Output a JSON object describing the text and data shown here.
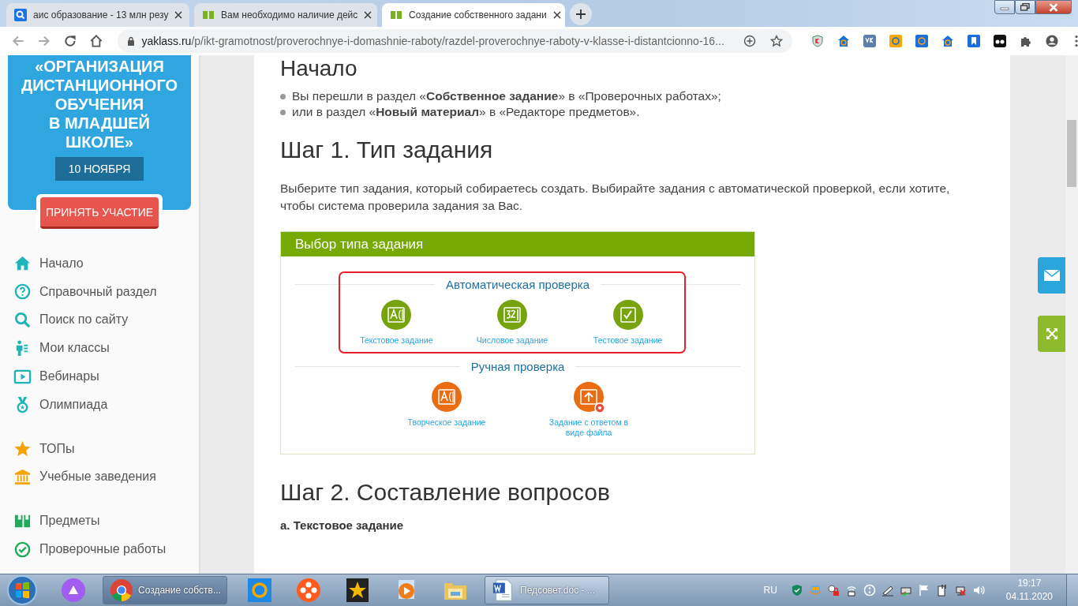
{
  "browser": {
    "tabs": [
      {
        "title": "аис образование - 13 млн резу",
        "selected": false
      },
      {
        "title": "Вам необходимо наличие дейс",
        "selected": false
      },
      {
        "title": "Создание собственного задани",
        "selected": true
      }
    ],
    "url": {
      "domain": "yaklass.ru",
      "path": "/p/ikt-gramotnost/proverochnye-i-domashnie-raboty/razdel-proverochnye-raboty-v-klasse-i-distantcionno-16..."
    }
  },
  "sidebar": {
    "banner": {
      "title_lines": [
        "«ОРГАНИЗАЦИЯ",
        "ДИСТАНЦИОННОГО",
        "ОБУЧЕНИЯ",
        "В МЛАДШЕЙ",
        "ШКОЛЕ»"
      ],
      "date": "10 НОЯБРЯ",
      "button": "ПРИНЯТЬ УЧАСТИЕ"
    },
    "nav_groups": [
      [
        "Начало",
        "Справочный раздел",
        "Поиск по сайту",
        "Мои классы",
        "Вебинары",
        "Олимпиада"
      ],
      [
        "ТОПы",
        "Учебные заведения"
      ],
      [
        "Предметы",
        "Проверочные работы"
      ]
    ]
  },
  "main": {
    "top_heading": "Начало",
    "bullets": [
      "Вы перешли в раздел «**Собственное задание**» в «Проверочных работах»;",
      "или в раздел «**Новый материал**» в «Редакторе предметов»."
    ],
    "step1": {
      "heading": "Шаг 1. Тип задания",
      "text": "Выберите тип задания, который собираетесь создать. Выбирайте задания с автоматической проверкой, если хотите, чтобы система проверила задания за Вас.",
      "figure": {
        "title": "Выбор типа задания",
        "groups": [
          {
            "heading": "Автоматическая проверка",
            "color": "#77a30e",
            "highlighted": true,
            "items": [
              "Текстовое задание",
              "Числовое задание",
              "Тестовое задание"
            ]
          },
          {
            "heading": "Ручная проверка",
            "color": "#ea6d13",
            "highlighted": false,
            "items": [
              "Творческое задание",
              "Задание с ответом в виде файла"
            ]
          }
        ]
      }
    },
    "step2": {
      "heading": "Шаг 2. Составление вопросов",
      "subheading": "а. Текстовое задание"
    }
  },
  "taskbar": {
    "items": [
      {
        "label": "Создание собств...",
        "selected": true
      },
      {
        "label": "Педсовет.doc - ...",
        "selected": false
      }
    ],
    "language": "RU",
    "time": "19:17",
    "date": "04.11.2020"
  }
}
